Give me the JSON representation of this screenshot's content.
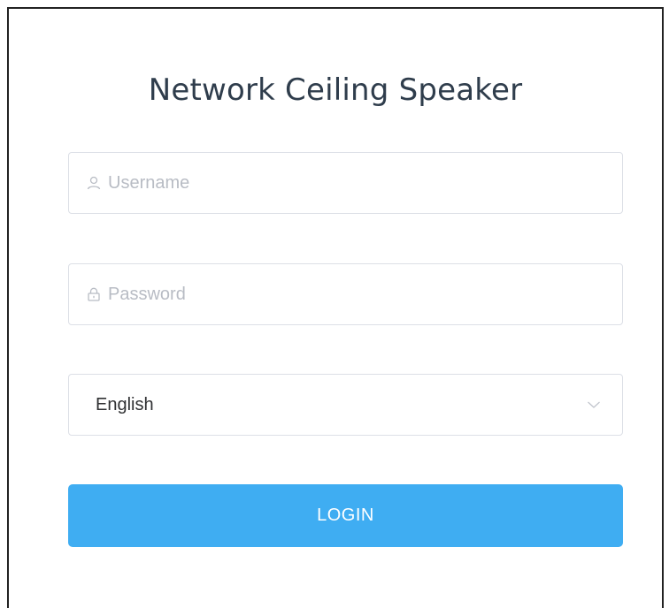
{
  "login": {
    "title": "Network Ceiling Speaker",
    "username": {
      "placeholder": "Username",
      "value": "",
      "icon": "user-icon"
    },
    "password": {
      "placeholder": "Password",
      "value": "",
      "icon": "lock-icon"
    },
    "language": {
      "selected": "English",
      "icon": "chevron-down-icon"
    },
    "submit_label": "LOGIN"
  },
  "colors": {
    "title": "#2f3d4c",
    "input_border": "#dcdfe6",
    "placeholder": "#b8bcc4",
    "button_bg": "#3fadf2",
    "button_text": "#ffffff"
  }
}
